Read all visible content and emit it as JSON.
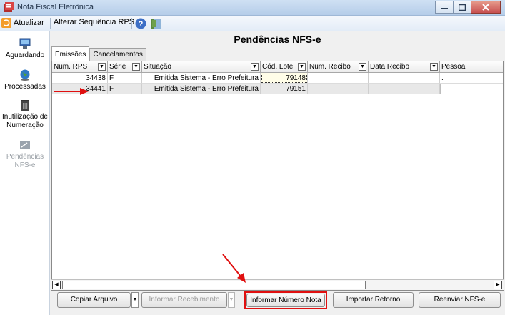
{
  "window": {
    "title": "Nota Fiscal Eletrônica"
  },
  "toolbar": {
    "refresh_label": "Atualizar",
    "alter_sequence_label": "Alterar Sequência RPS"
  },
  "sidebar": {
    "items": [
      {
        "label": "Aguardando",
        "icon": "monitor-icon"
      },
      {
        "label": "Processadas",
        "icon": "globe-icon"
      },
      {
        "label": "Inutilização de Numeração",
        "icon": "trash-icon"
      },
      {
        "label": "Pendências NFS-e",
        "icon": "document-icon",
        "disabled": true
      }
    ]
  },
  "main": {
    "title": "Pendências NFS-e",
    "tabs": [
      {
        "label": "Emissões",
        "active": true
      },
      {
        "label": "Cancelamentos",
        "active": false
      }
    ],
    "columns": [
      "Num. RPS",
      "Série",
      "Situação",
      "Cód. Lote",
      "Num. Recibo",
      "Data Recibo",
      "Pessoa"
    ],
    "rows": [
      {
        "num_rps": "34438",
        "serie": "F",
        "situacao": "Emitida Sistema - Erro Prefeitura",
        "cod_lote": "79148",
        "num_recibo": "",
        "data_recibo": "",
        "pessoa": "."
      },
      {
        "num_rps": "34441",
        "serie": "F",
        "situacao": "Emitida Sistema - Erro Prefeitura",
        "cod_lote": "79151",
        "num_recibo": "",
        "data_recibo": "",
        "pessoa": ""
      }
    ]
  },
  "buttons": {
    "copy_file": "Copiar Arquivo",
    "inform_receipt": "Informar Recebimento",
    "inform_note_number": "Informar Número Nota",
    "import_return": "Importar Retorno",
    "resend_nfse": "Reenviar NFS-e"
  },
  "colors": {
    "highlight": "#e01010",
    "title_bar": "#b5cde9",
    "selected_row": "#e8e8e8"
  }
}
